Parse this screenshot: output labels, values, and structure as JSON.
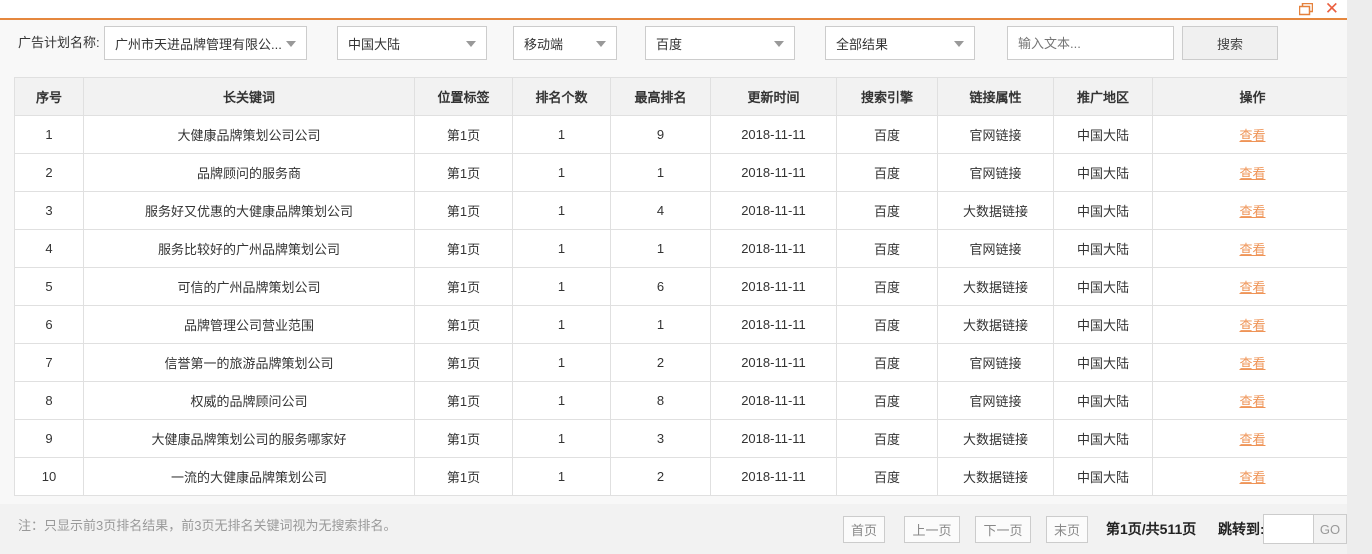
{
  "filters": {
    "label": "广告计划名称:",
    "campaign": "广州市天进品牌管理有限公...",
    "region": "中国大陆",
    "device": "移动端",
    "engine": "百度",
    "result_scope": "全部结果",
    "search_placeholder": "输入文本...",
    "search_button": "搜索"
  },
  "table": {
    "headers": [
      "序号",
      "长关键词",
      "位置标签",
      "排名个数",
      "最高排名",
      "更新时间",
      "搜索引擎",
      "链接属性",
      "推广地区",
      "操作"
    ],
    "rows": [
      [
        "1",
        "大健康品牌策划公司公司",
        "第1页",
        "1",
        "9",
        "2018-11-11",
        "百度",
        "官网链接",
        "中国大陆",
        "查看"
      ],
      [
        "2",
        "品牌顾问的服务商",
        "第1页",
        "1",
        "1",
        "2018-11-11",
        "百度",
        "官网链接",
        "中国大陆",
        "查看"
      ],
      [
        "3",
        "服务好又优惠的大健康品牌策划公司",
        "第1页",
        "1",
        "4",
        "2018-11-11",
        "百度",
        "大数据链接",
        "中国大陆",
        "查看"
      ],
      [
        "4",
        "服务比较好的广州品牌策划公司",
        "第1页",
        "1",
        "1",
        "2018-11-11",
        "百度",
        "官网链接",
        "中国大陆",
        "查看"
      ],
      [
        "5",
        "可信的广州品牌策划公司",
        "第1页",
        "1",
        "6",
        "2018-11-11",
        "百度",
        "大数据链接",
        "中国大陆",
        "查看"
      ],
      [
        "6",
        "品牌管理公司营业范围",
        "第1页",
        "1",
        "1",
        "2018-11-11",
        "百度",
        "大数据链接",
        "中国大陆",
        "查看"
      ],
      [
        "7",
        "信誉第一的旅游品牌策划公司",
        "第1页",
        "1",
        "2",
        "2018-11-11",
        "百度",
        "官网链接",
        "中国大陆",
        "查看"
      ],
      [
        "8",
        "权威的品牌顾问公司",
        "第1页",
        "1",
        "8",
        "2018-11-11",
        "百度",
        "官网链接",
        "中国大陆",
        "查看"
      ],
      [
        "9",
        "大健康品牌策划公司的服务哪家好",
        "第1页",
        "1",
        "3",
        "2018-11-11",
        "百度",
        "大数据链接",
        "中国大陆",
        "查看"
      ],
      [
        "10",
        "一流的大健康品牌策划公司",
        "第1页",
        "1",
        "2",
        "2018-11-11",
        "百度",
        "大数据链接",
        "中国大陆",
        "查看"
      ]
    ]
  },
  "footer": {
    "note": "注：只显示前3页排名结果，前3页无排名关键词视为无搜索排名。",
    "pagination": {
      "first": "首页",
      "prev": "上一页",
      "next": "下一页",
      "last": "末页",
      "page_info": "第1页/共511页",
      "jump_label": "跳转到:",
      "jump_value": "",
      "go": "GO"
    }
  },
  "colors": {
    "accent_orange": "#e5873e",
    "link_orange": "#ef9457",
    "close_red": "#ea5f3f",
    "header_bg": "#f2f2f2"
  }
}
